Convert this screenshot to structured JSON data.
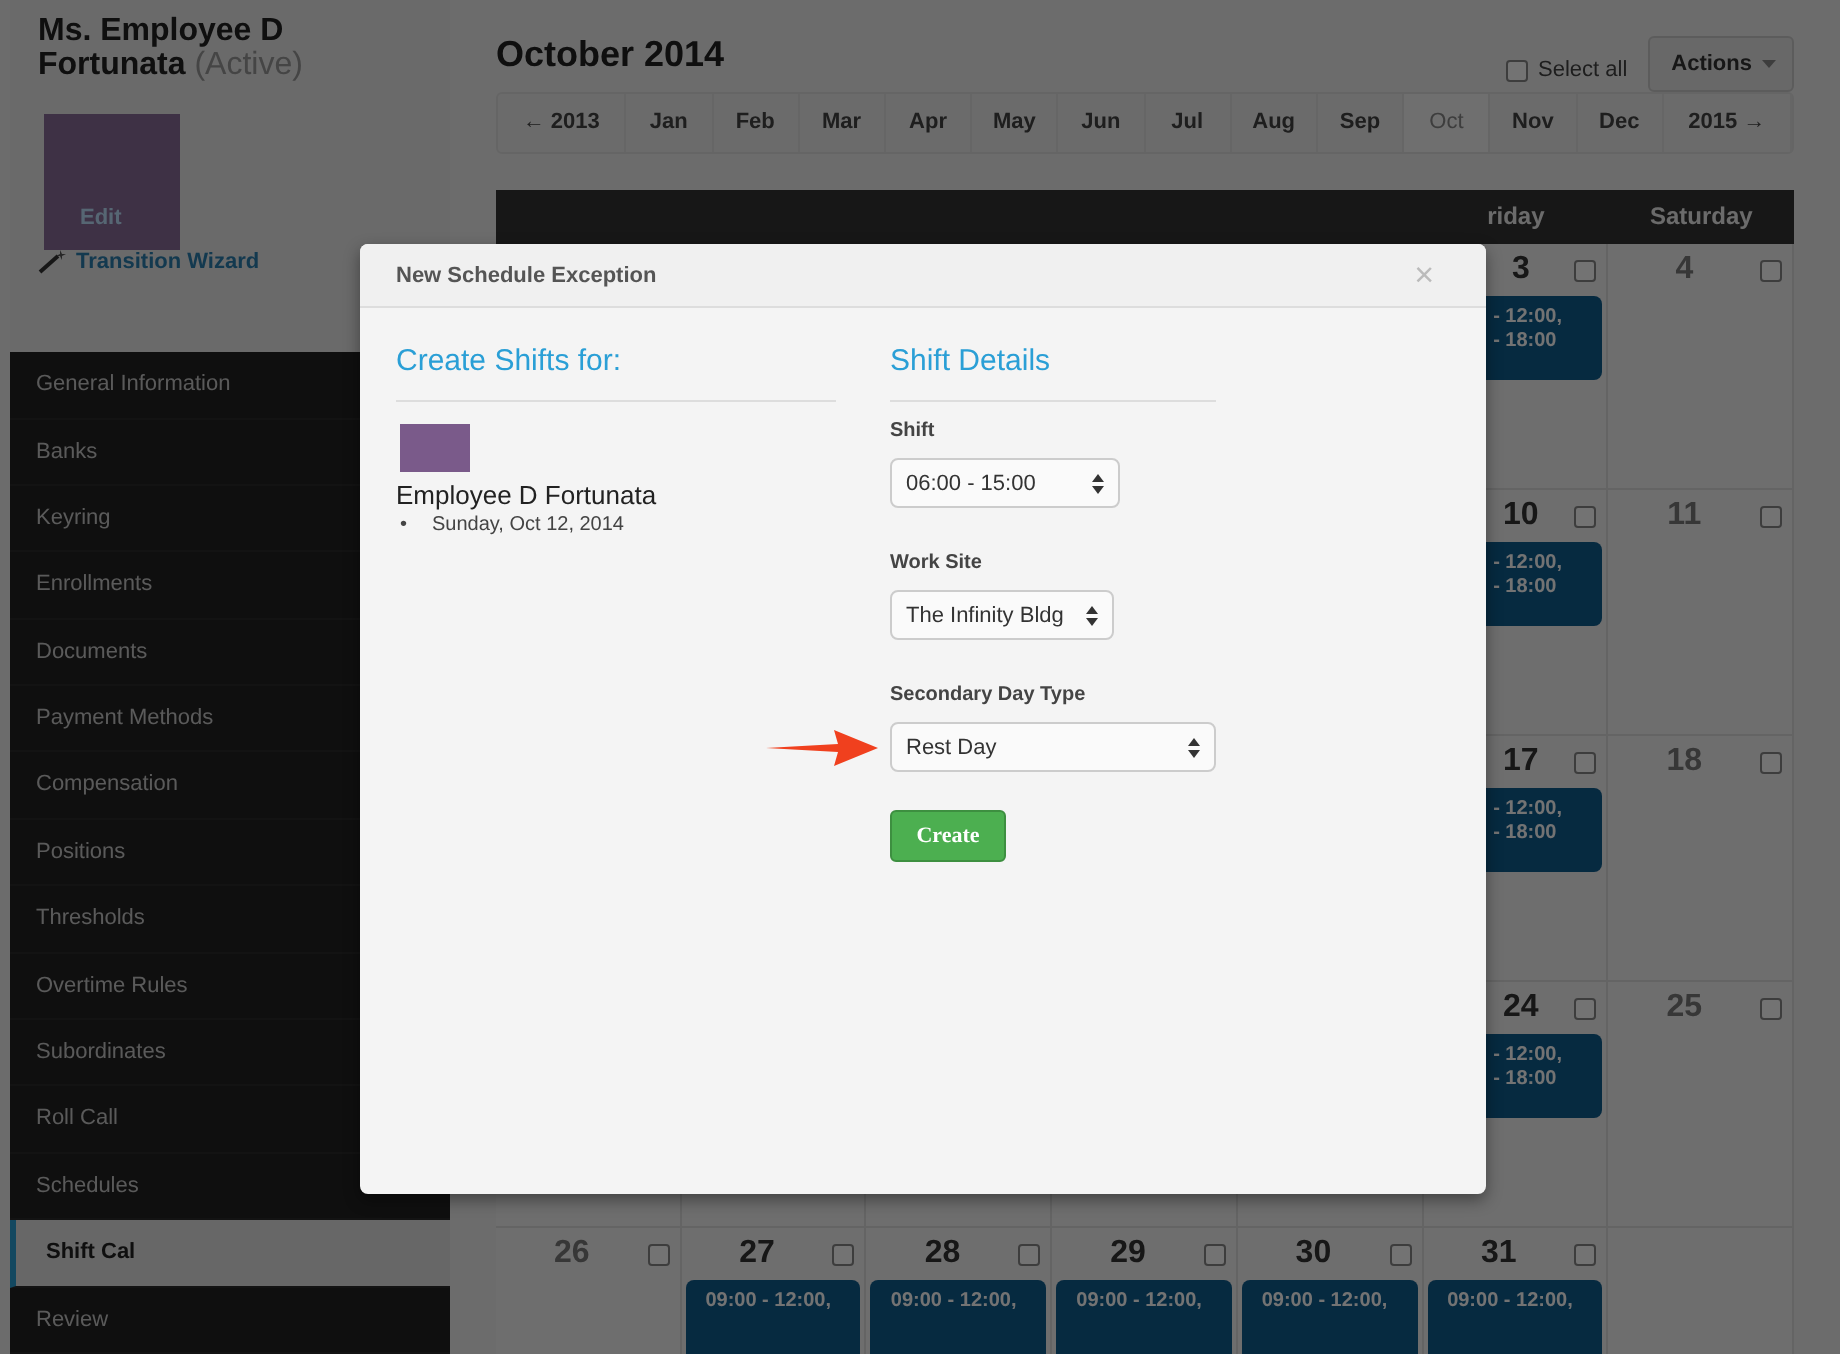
{
  "employee": {
    "name": "Ms. Employee D Fortunata",
    "status": "(Active)",
    "edit_link": "Edit",
    "wizard_link": "Transition Wizard"
  },
  "sidebar": {
    "items": [
      {
        "label": "General Information",
        "selected": false
      },
      {
        "label": "Banks",
        "selected": false
      },
      {
        "label": "Keyring",
        "selected": false
      },
      {
        "label": "Enrollments",
        "selected": false
      },
      {
        "label": "Documents",
        "selected": false
      },
      {
        "label": "Payment Methods",
        "selected": false
      },
      {
        "label": "Compensation",
        "selected": false
      },
      {
        "label": "Positions",
        "selected": false
      },
      {
        "label": "Thresholds",
        "selected": false
      },
      {
        "label": "Overtime Rules",
        "selected": false
      },
      {
        "label": "Subordinates",
        "selected": false
      },
      {
        "label": "Roll Call",
        "selected": false
      },
      {
        "label": "Schedules",
        "selected": false
      },
      {
        "label": "Shift Cal",
        "selected": true
      },
      {
        "label": "Review",
        "selected": false
      }
    ]
  },
  "header": {
    "title": "October 2014",
    "select_all": {
      "label": "Select all",
      "checked": false
    },
    "actions_button": "Actions"
  },
  "month_nav": [
    {
      "label": "← 2013",
      "selected": false
    },
    {
      "label": "Jan",
      "selected": false
    },
    {
      "label": "Feb",
      "selected": false
    },
    {
      "label": "Mar",
      "selected": false
    },
    {
      "label": "Apr",
      "selected": false
    },
    {
      "label": "May",
      "selected": false
    },
    {
      "label": "Jun",
      "selected": false
    },
    {
      "label": "Jul",
      "selected": false
    },
    {
      "label": "Aug",
      "selected": false
    },
    {
      "label": "Sep",
      "selected": false
    },
    {
      "label": "Oct",
      "selected": true
    },
    {
      "label": "Nov",
      "selected": false
    },
    {
      "label": "Dec",
      "selected": false
    },
    {
      "label": "2015 →",
      "selected": false
    }
  ],
  "calendar": {
    "weekdays": [
      "riday",
      "Saturday"
    ],
    "weeks": [
      {
        "friday": {
          "date": "3",
          "dim": false,
          "checked": false,
          "event": [
            "- 12:00,",
            "- 18:00"
          ]
        },
        "saturday": {
          "date": "4",
          "dim": true,
          "checked": false
        }
      },
      {
        "friday": {
          "date": "10",
          "dim": false,
          "checked": false,
          "event": [
            "- 12:00,",
            "- 18:00"
          ]
        },
        "saturday": {
          "date": "11",
          "dim": true,
          "checked": false
        }
      },
      {
        "friday": {
          "date": "17",
          "dim": false,
          "checked": false,
          "event": [
            "- 12:00,",
            "- 18:00"
          ]
        },
        "saturday": {
          "date": "18",
          "dim": true,
          "checked": false
        }
      },
      {
        "friday": {
          "date": "24",
          "dim": false,
          "checked": false,
          "event": [
            "- 12:00,",
            "- 18:00"
          ]
        },
        "saturday": {
          "date": "25",
          "dim": true,
          "checked": false
        }
      }
    ],
    "last_week": [
      {
        "date": "26",
        "dim": true,
        "checked": false
      },
      {
        "date": "27",
        "dim": false,
        "checked": false,
        "event": [
          "09:00 - 12:00,"
        ]
      },
      {
        "date": "28",
        "dim": false,
        "checked": false,
        "event": [
          "09:00 - 12:00,"
        ]
      },
      {
        "date": "29",
        "dim": false,
        "checked": false,
        "event": [
          "09:00 - 12:00,"
        ]
      },
      {
        "date": "30",
        "dim": false,
        "checked": false,
        "event": [
          "09:00 - 12:00,"
        ]
      },
      {
        "date": "31",
        "dim": false,
        "checked": false,
        "event": [
          "09:00 - 12:00,"
        ]
      }
    ]
  },
  "modal": {
    "title": "New Schedule Exception",
    "close": "×",
    "left": {
      "heading": "Create Shifts for:",
      "employee_name": "Employee D Fortunata",
      "dates": [
        {
          "bullet": "•",
          "text": "Sunday, Oct 12, 2014"
        }
      ]
    },
    "right": {
      "heading": "Shift Details",
      "fields": [
        {
          "label": "Shift",
          "value": "06:00 - 15:00",
          "annotated": false
        },
        {
          "label": "Work Site",
          "value": "The Infinity Bldg",
          "annotated": false
        },
        {
          "label": "Secondary Day Type",
          "value": "Rest Day",
          "annotated": true
        }
      ],
      "create_button": "Create"
    }
  }
}
